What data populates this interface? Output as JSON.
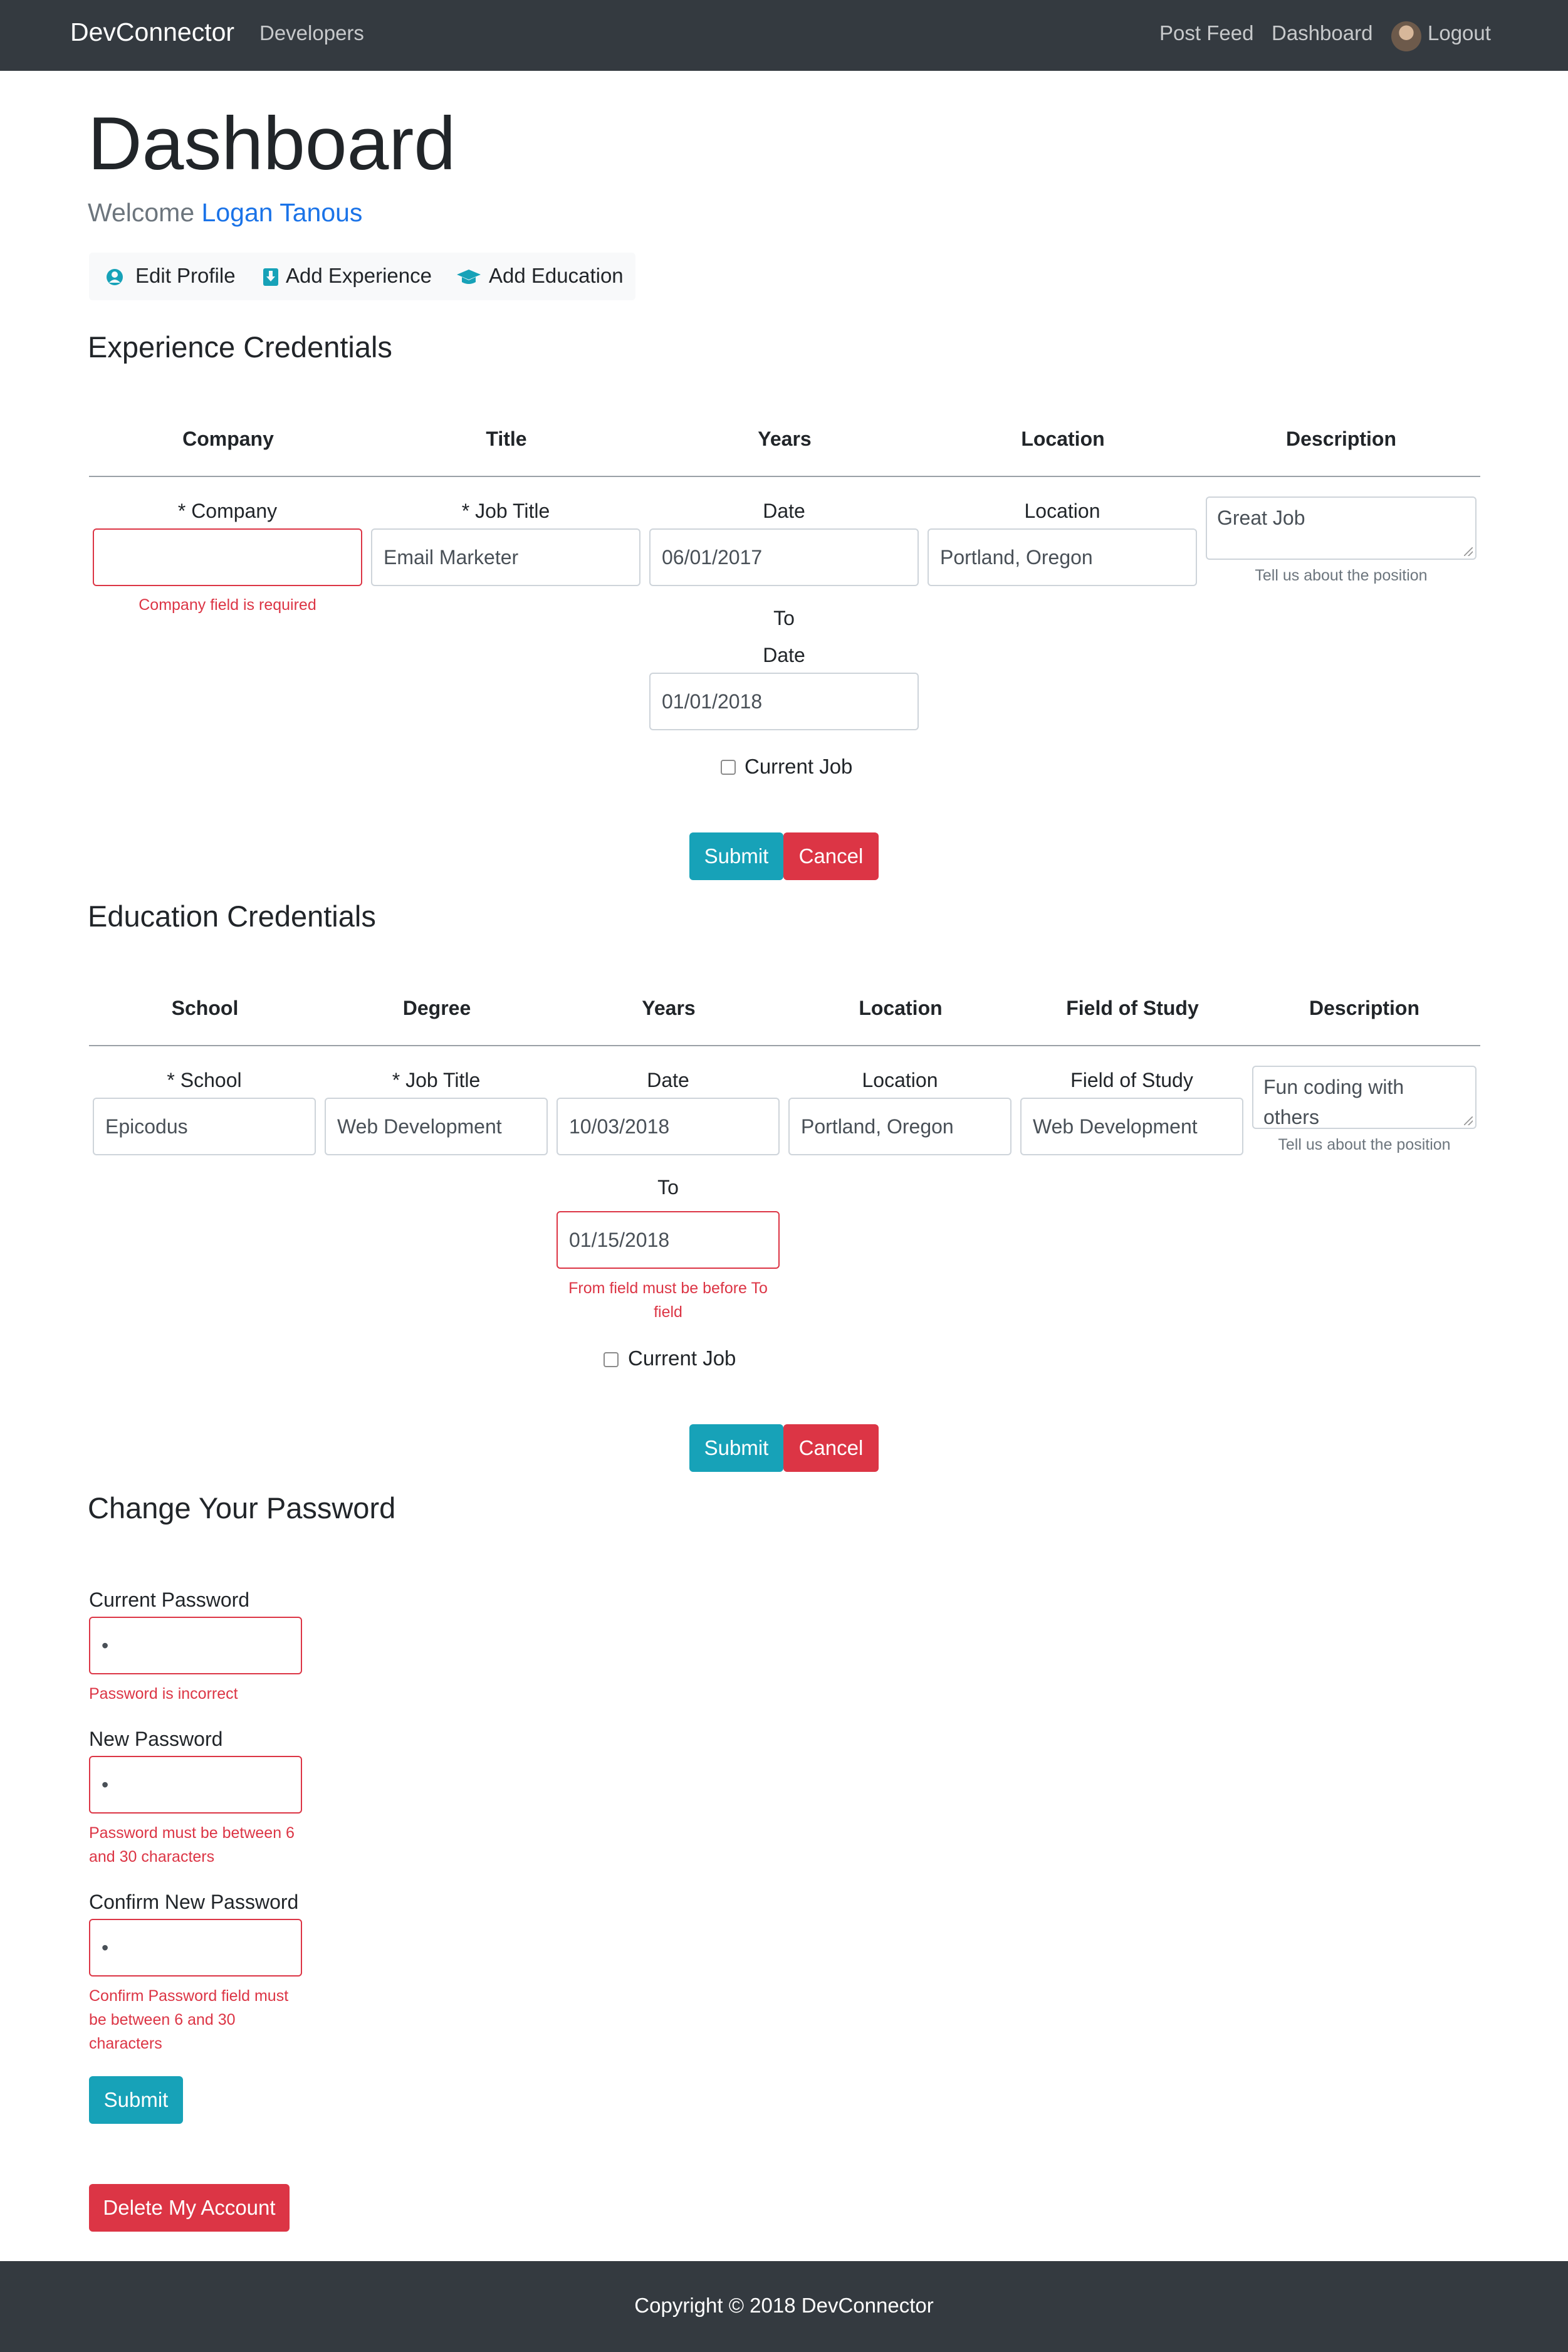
{
  "navbar": {
    "brand": "DevConnector",
    "developers": "Developers",
    "post_feed": "Post Feed",
    "dashboard": "Dashboard",
    "logout": "Logout"
  },
  "page": {
    "title": "Dashboard",
    "welcome_prefix": "Welcome",
    "user_name": "Logan Tanous"
  },
  "actions": {
    "edit_profile": "Edit Profile",
    "add_experience": "Add Experience",
    "add_education": "Add Education"
  },
  "experience": {
    "heading": "Experience Credentials",
    "columns": [
      "Company",
      "Title",
      "Years",
      "Location",
      "Description"
    ],
    "labels": {
      "company": "* Company",
      "job_title": "* Job Title",
      "date_from": "Date",
      "location": "Location",
      "to": "To",
      "date_to": "Date"
    },
    "values": {
      "company": "",
      "job_title": "Email Marketer",
      "from": "06/01/2017",
      "location": "Portland, Oregon",
      "to": "01/01/2018",
      "description": "Great Job"
    },
    "description_help": "Tell us about the position",
    "company_error": "Company field is required",
    "current_job_label": "Current Job",
    "submit": "Submit",
    "cancel": "Cancel"
  },
  "education": {
    "heading": "Education Credentials",
    "columns": [
      "School",
      "Degree",
      "Years",
      "Location",
      "Field of Study",
      "Description"
    ],
    "labels": {
      "school": "* School",
      "job_title": "* Job Title",
      "date": "Date",
      "location": "Location",
      "field_of_study": "Field of Study",
      "to": "To"
    },
    "values": {
      "school": "Epicodus",
      "degree": "Web Development",
      "from": "10/03/2018",
      "location": "Portland, Oregon",
      "field_of_study": "Web Development",
      "to": "01/15/2018",
      "description_line1": "Fun coding with",
      "description_line2": "others"
    },
    "description_help": "Tell us about the position",
    "date_error_line1": "From field must be before To",
    "date_error_line2": "field",
    "current_job_label": "Current Job",
    "submit": "Submit",
    "cancel": "Cancel"
  },
  "password": {
    "heading": "Change Your Password",
    "current_label": "Current Password",
    "current_value": "•",
    "current_error": "Password is incorrect",
    "new_label": "New Password",
    "new_value": "•",
    "new_error_line1": "Password must be between 6",
    "new_error_line2": "and 30 characters",
    "confirm_label": "Confirm New Password",
    "confirm_value": "•",
    "confirm_error_line1": "Confirm Password field must",
    "confirm_error_line2": "be between 6 and 30",
    "confirm_error_line3": "characters",
    "submit": "Submit"
  },
  "delete_account": "Delete My Account",
  "footer": "Copyright © 2018 DevConnector",
  "colors": {
    "navbar_bg": "#343a40",
    "info": "#17a2b8",
    "danger": "#dc3545",
    "link": "#1a73e8"
  }
}
